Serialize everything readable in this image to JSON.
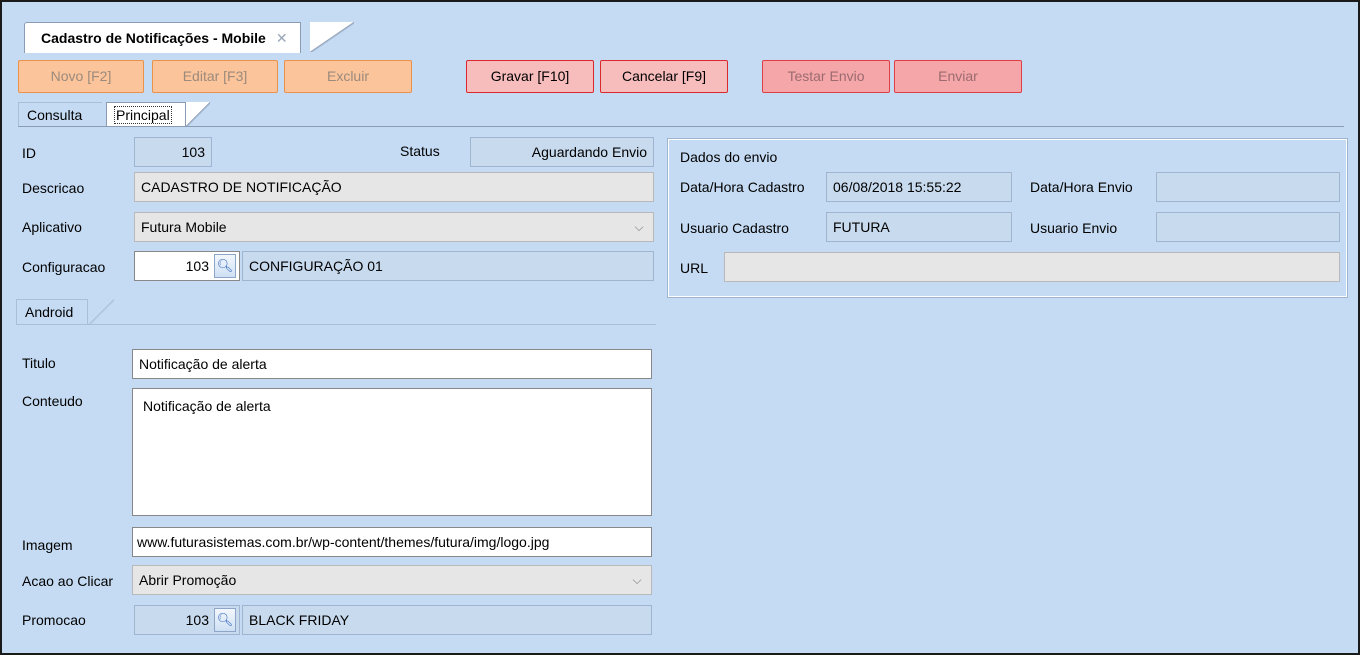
{
  "window": {
    "tab_title": "Cadastro de Notificações - Mobile",
    "close_glyph": "✕"
  },
  "toolbar": {
    "novo": "Novo [F2]",
    "editar": "Editar [F3]",
    "excluir": "Excluir",
    "gravar": "Gravar [F10]",
    "cancelar": "Cancelar [F9]",
    "testar_envio": "Testar Envio",
    "enviar": "Enviar"
  },
  "tabs": {
    "consulta": "Consulta",
    "principal": "Principal"
  },
  "form": {
    "id_label": "ID",
    "id_value": "103",
    "status_label": "Status",
    "status_value": "Aguardando Envio",
    "descricao_label": "Descricao",
    "descricao_value": "CADASTRO DE NOTIFICAÇÃO",
    "aplicativo_label": "Aplicativo",
    "aplicativo_value": "Futura Mobile",
    "configuracao_label": "Configuracao",
    "configuracao_code": "103",
    "configuracao_name": "CONFIGURAÇÃO 01"
  },
  "envio": {
    "title": "Dados do envio",
    "data_cadastro_label": "Data/Hora Cadastro",
    "data_cadastro_value": "06/08/2018 15:55:22",
    "data_envio_label": "Data/Hora Envio",
    "data_envio_value": "",
    "usuario_cadastro_label": "Usuario Cadastro",
    "usuario_cadastro_value": "FUTURA",
    "usuario_envio_label": "Usuario Envio",
    "usuario_envio_value": "",
    "url_label": "URL",
    "url_value": ""
  },
  "android": {
    "tab": "Android",
    "titulo_label": "Titulo",
    "titulo_value": "Notificação de alerta",
    "conteudo_label": "Conteudo",
    "conteudo_value": "Notificação de alerta",
    "imagem_label": "Imagem",
    "imagem_value": "www.futurasistemas.com.br/wp-content/themes/futura/img/logo.jpg",
    "acao_label": "Acao ao Clicar",
    "acao_value": "Abrir Promoção",
    "promocao_label": "Promocao",
    "promocao_code": "103",
    "promocao_name": "BLACK FRIDAY"
  },
  "icons": {
    "lookup": "magnifier-icon",
    "dropdown": "chevron-down-icon",
    "close": "close-icon"
  },
  "colors": {
    "background": "#c5dbf3",
    "orange_button": "#fbc49a",
    "red_button": "#f4a6a8"
  }
}
